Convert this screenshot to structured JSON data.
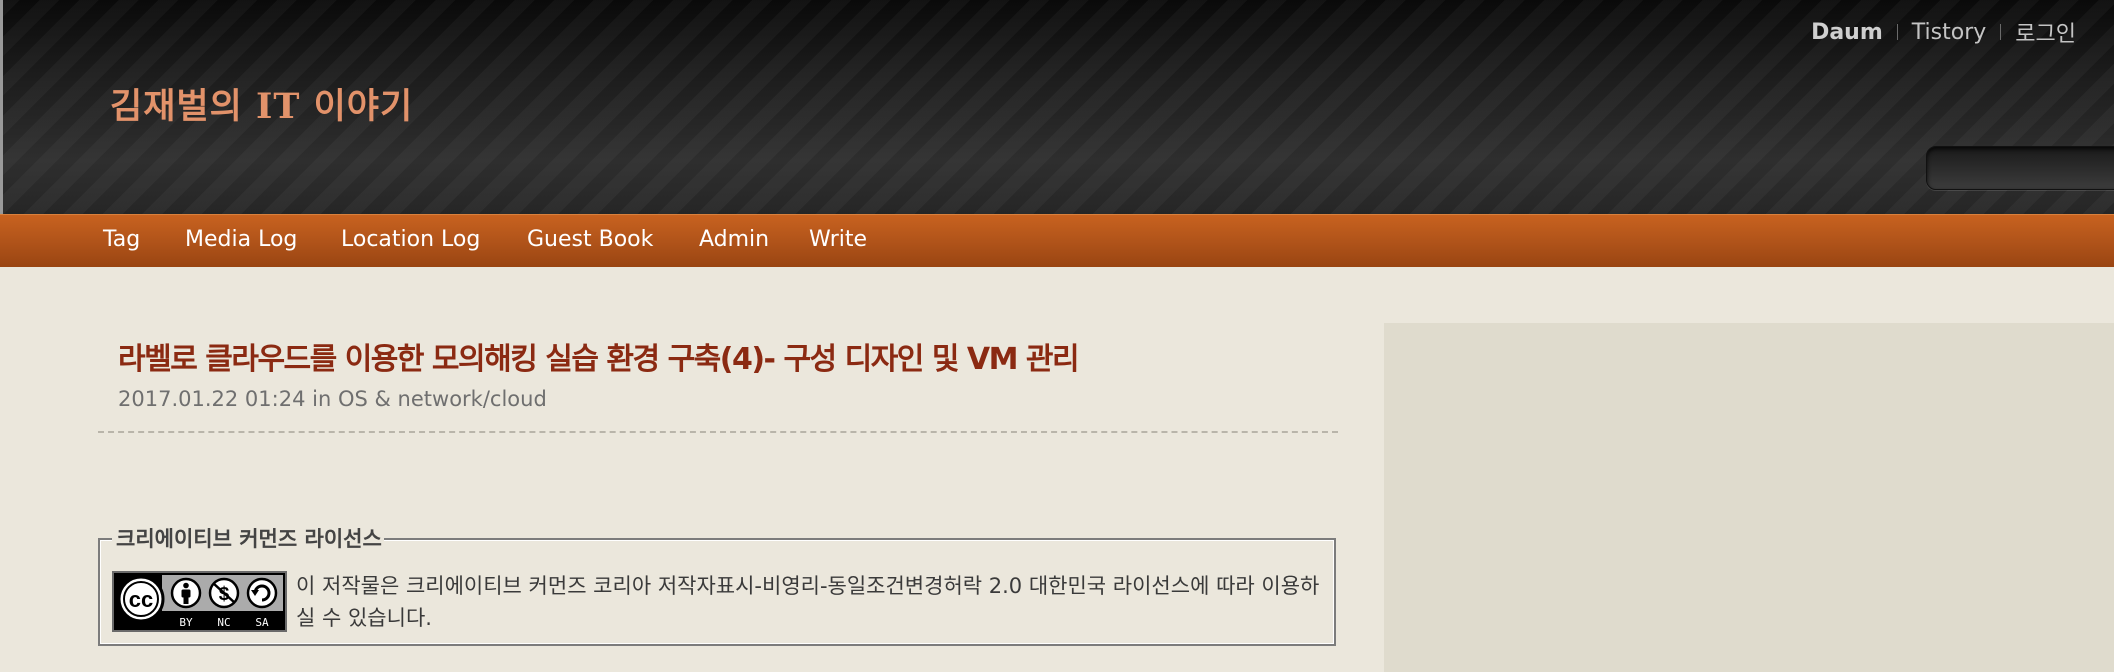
{
  "header": {
    "site_title": "김재벌의 IT 이야기",
    "top_links": [
      "Daum",
      "Tistory",
      "로그인"
    ],
    "search": {
      "value": "",
      "placeholder": ""
    }
  },
  "nav": {
    "items": [
      "Tag",
      "Media Log",
      "Location Log",
      "Guest Book",
      "Admin",
      "Write"
    ]
  },
  "post": {
    "title": "라벨로 클라우드를 이용한 모의해킹 실습 환경 구축(4)- 구성 디자인 및 VM 관리",
    "date": "2017.01.22 01:24",
    "in_word": "in",
    "category": "OS & network/cloud"
  },
  "license": {
    "legend": "크리에이티브 커먼즈 라이선스",
    "badge_labels": [
      "BY",
      "NC",
      "SA"
    ],
    "text_before": "이 저작물은 ",
    "text_link": "크리에이티브 커먼즈 코리아 저작자표시-비영리-동일조건변경허락 2.0 대한민국 라이선스",
    "text_after": "에 따라 이용하실 수 있습니다."
  },
  "colors": {
    "accent": "#b5561b",
    "title": "#8b2a12",
    "site_title": "#e2926a",
    "background": "#ebe7dc",
    "sidebar": "#dfdbcd"
  },
  "icons": [
    "cc-icon",
    "attribution-icon",
    "noncommercial-icon",
    "sharealike-icon"
  ]
}
